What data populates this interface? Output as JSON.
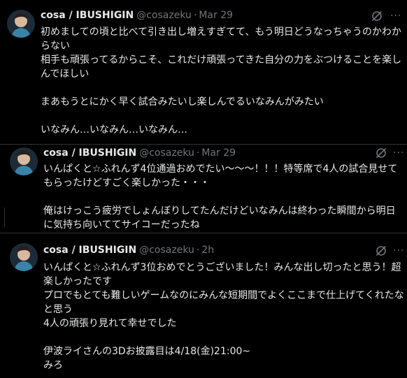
{
  "tweets": [
    {
      "author": "cosa / IBUSHIGIN",
      "handle": "@cosazeku",
      "separator": "·",
      "time": "Mar 29",
      "text": "初めましての頃と比べて引き出し増えすぎてて、もう明日どうなっちゃうのかわからない\n相手も頑張ってるからこそ、これだけ頑張ってきた自分の力をぶつけることを楽しんでほしい\n\nまあもうとにかく早く試合みたいし楽しんでるいなみんがみたい\n\nいなみん…いなみん…いなみん…",
      "grok_icon": "grok-icon",
      "more_icon": "more-icon",
      "more_glyph": "···"
    },
    {
      "author": "cosa / IBUSHIGIN",
      "handle": "@cosazeku",
      "separator": "·",
      "time": "Mar 29",
      "text": "いんぱくと☆ふれんず4位通過おめでたい〜〜〜！！！特等席で4人の試合見せてもらったけどすごく楽しかった・・・\n\n俺はけっこう疲労でしょんぼりしてたんだけどいなみんは終わった瞬間から明日に気持ち向いててサイコーだったね",
      "grok_icon": "grok-icon",
      "more_icon": "more-icon",
      "more_glyph": "···"
    },
    {
      "author": "cosa / IBUSHIGIN",
      "handle": "@cosazeku",
      "separator": "·",
      "time": "2h",
      "text": "いんぱくと☆ふれんず3位おめでとうございました！みんな出し切ったと思う！超楽しかったです\nプロでもとても難しいゲームなのにみんな短期間でよくここまで仕上げてくれたなと思う\n4人の頑張り見れて幸せでした\n\n伊波ライさんの3Dお披露目は4/18(金)21:00~\nみろ",
      "grok_icon": "grok-icon",
      "more_icon": "more-icon",
      "more_glyph": "···"
    }
  ],
  "colors": {
    "background": "#000000",
    "text": "#e7e9ea",
    "secondary": "#71767b",
    "divider": "#2f3336"
  }
}
